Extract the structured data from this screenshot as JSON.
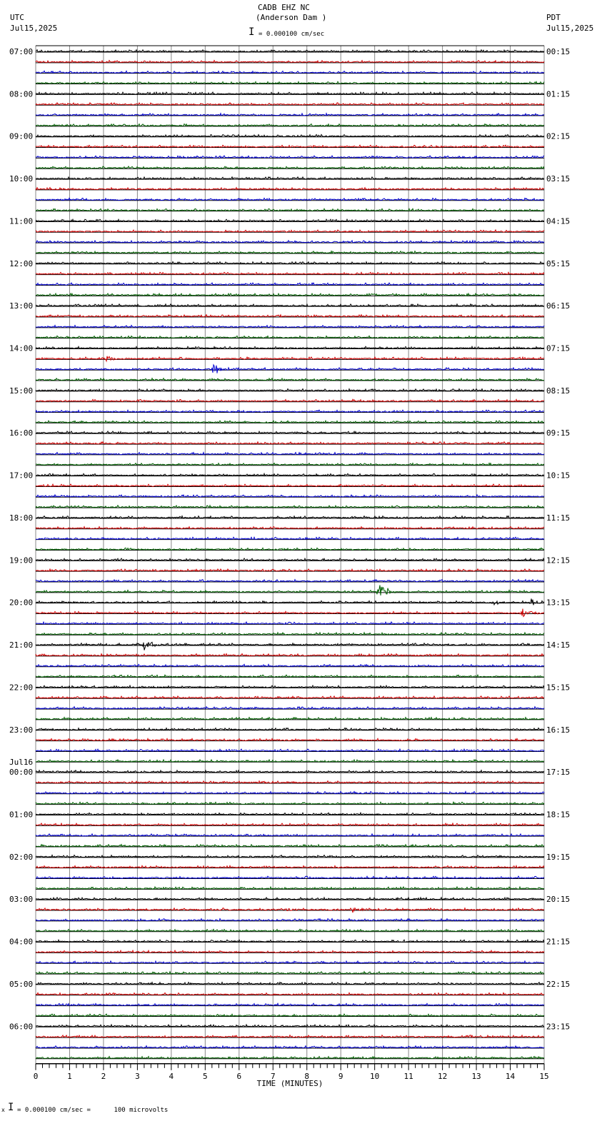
{
  "header": {
    "station": "CADB EHZ NC",
    "location": "(Anderson Dam )",
    "left_tz": "UTC",
    "left_date": "Jul15,2025",
    "right_tz": "PDT",
    "right_date": "Jul15,2025",
    "scale_text": "= 0.000100 cm/sec"
  },
  "footer": {
    "scale_text": "= 0.000100 cm/sec =      100 microvolts",
    "marker": "x"
  },
  "chart_data": {
    "type": "line",
    "title": "CADB EHZ NC (Anderson Dam )",
    "xlabel": "TIME (MINUTES)",
    "xlim": [
      0,
      15
    ],
    "x_ticks": [
      "0",
      "1",
      "2",
      "3",
      "4",
      "5",
      "6",
      "7",
      "8",
      "9",
      "10",
      "11",
      "12",
      "13",
      "14",
      "15"
    ],
    "traces_per_hour": 4,
    "trace_count": 96,
    "trace_colors": [
      "#000000",
      "#d00000",
      "#0000d0",
      "#006000"
    ],
    "left_labels": [
      "07:00",
      "08:00",
      "09:00",
      "10:00",
      "11:00",
      "12:00",
      "13:00",
      "14:00",
      "15:00",
      "16:00",
      "17:00",
      "18:00",
      "19:00",
      "20:00",
      "21:00",
      "22:00",
      "23:00",
      "00:00",
      "01:00",
      "02:00",
      "03:00",
      "04:00",
      "05:00",
      "06:00"
    ],
    "left_date_change": {
      "hour_index": 17,
      "label": "Jul16"
    },
    "right_labels": [
      "00:15",
      "01:15",
      "02:15",
      "03:15",
      "04:15",
      "05:15",
      "06:15",
      "07:15",
      "08:15",
      "09:15",
      "10:15",
      "11:15",
      "12:15",
      "13:15",
      "14:15",
      "15:15",
      "16:15",
      "17:15",
      "18:15",
      "19:15",
      "20:15",
      "21:15",
      "22:15",
      "23:15"
    ],
    "events": [
      {
        "trace": 29,
        "minute": 2.0,
        "duration": 0.5,
        "amplitude": 7
      },
      {
        "trace": 30,
        "minute": 5.2,
        "duration": 0.5,
        "amplitude": 12
      },
      {
        "trace": 51,
        "minute": 10.1,
        "duration": 0.6,
        "amplitude": 13
      },
      {
        "trace": 52,
        "minute": 13.5,
        "duration": 0.5,
        "amplitude": 4
      },
      {
        "trace": 52,
        "minute": 14.6,
        "duration": 0.4,
        "amplitude": 8
      },
      {
        "trace": 53,
        "minute": 14.3,
        "duration": 0.6,
        "amplitude": 10
      },
      {
        "trace": 56,
        "minute": 3.2,
        "duration": 0.6,
        "amplitude": 12
      },
      {
        "trace": 81,
        "minute": 7.4,
        "duration": 0.5,
        "amplitude": 4
      },
      {
        "trace": 81,
        "minute": 9.3,
        "duration": 0.5,
        "amplitude": 5
      },
      {
        "trace": 57,
        "minute": 7.5,
        "duration": 0.3,
        "amplitude": 1
      }
    ]
  }
}
